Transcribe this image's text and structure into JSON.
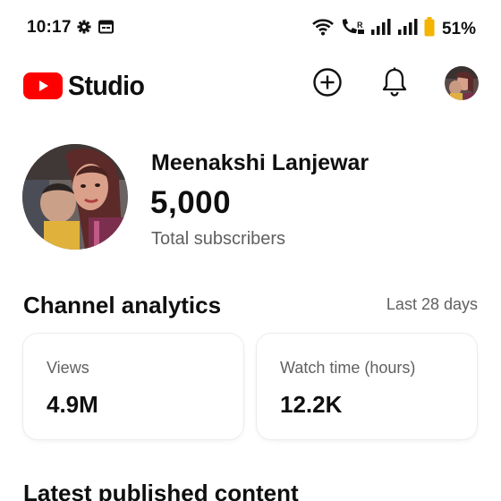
{
  "status_bar": {
    "time": "10:17",
    "battery_percent": "51%",
    "icons": [
      "gear-icon",
      "calendar-icon",
      "wifi-icon",
      "volte-call-icon",
      "signal-icon",
      "signal-icon",
      "battery-icon"
    ]
  },
  "app_bar": {
    "brand": "Studio",
    "brand_color": "#ff0000",
    "icons": [
      "create-plus-icon",
      "bell-icon"
    ]
  },
  "channel": {
    "name": "Meenakshi Lanjewar",
    "subscriber_count": "5,000",
    "subscriber_label": "Total subscribers"
  },
  "analytics": {
    "title": "Channel analytics",
    "range": "Last 28 days",
    "cards": [
      {
        "label": "Views",
        "value": "4.9M"
      },
      {
        "label": "Watch time (hours)",
        "value": "12.2K"
      }
    ]
  },
  "latest": {
    "title": "Latest published content"
  }
}
